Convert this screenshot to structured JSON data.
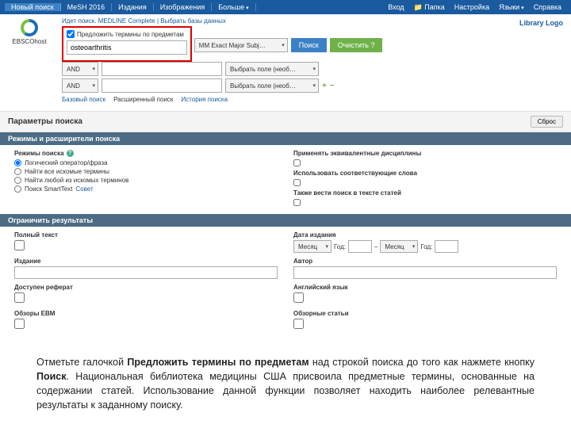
{
  "topbar": {
    "left": [
      "Новый поиск",
      "MeSH 2016",
      "Издания",
      "Изображения",
      "Больше"
    ],
    "right": [
      "Вход",
      "Папка",
      "Настройка",
      "Языки",
      "Справка"
    ]
  },
  "logo_text": "EBSCOhost",
  "library_logo": "Library Logo",
  "db_line": {
    "p1": "Идет поиск.",
    "p2": "MEDLINE Complete",
    "sep": "|",
    "p3": "Выбрать базы данных"
  },
  "suggest": {
    "checked": true,
    "label": "Предложить термины по предметам"
  },
  "search_rows": {
    "r1": {
      "value": "osteoarthritis",
      "field": "MM Exact Major Subj…"
    },
    "r2": {
      "bool": "AND",
      "value": "",
      "field": "Выбрать поле (необ…"
    },
    "r3": {
      "bool": "AND",
      "value": "",
      "field": "Выбрать поле (необ…"
    }
  },
  "buttons": {
    "search": "Поиск",
    "clear": "Очистить",
    "help": "?"
  },
  "tabs": [
    "Базовый поиск",
    "Расширенный поиск",
    "История поиска"
  ],
  "params": {
    "title": "Параметры поиска",
    "reset": "Сброс"
  },
  "modes": {
    "title": "Режимы и расширители поиска",
    "label": "Режимы поиска",
    "opts": [
      "Логический оператор/фраза",
      "Найти все искомые термины",
      "Найти любой из искомых терминов",
      "Поиск SmartText"
    ],
    "advice": "Совет",
    "right": {
      "equiv": "Применять эквивалентные дисциплины",
      "related": "Использовать соответствующие слова",
      "fulltext": "Также вести поиск в тексте статей"
    }
  },
  "limits": {
    "title": "Ограничить результаты",
    "fulltext": "Полный текст",
    "publication": "Издание",
    "abstract": "Доступен реферат",
    "ebm": "Обзоры EBM",
    "date": "Дата издания",
    "month": "Месяц",
    "year": "Год:",
    "dash": "–",
    "author": "Автор",
    "english": "Английский язык",
    "review": "Обзорные статьи"
  },
  "caption": {
    "t1": "Отметьте галочкой ",
    "b1": "Предложить термины по предметам",
    "t2": " над строкой поиска до того как нажмете кнопку ",
    "b2": "Поиск",
    "t3": ". Национальная библиотека медицины США присвоила предметные термины, основанные на содержании статей. Использование данной функции позволяет находить наиболее релевантные результаты к заданному поиску."
  }
}
